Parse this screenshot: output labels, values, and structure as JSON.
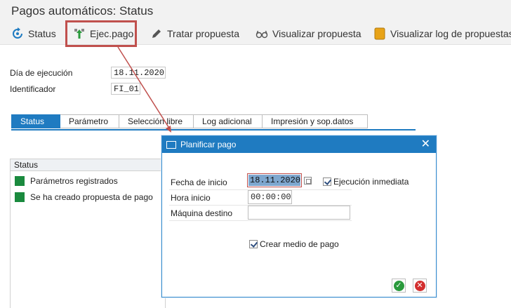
{
  "window": {
    "title": "Pagos automáticos: Status"
  },
  "toolbar": {
    "status": "Status",
    "ejec_pago": "Ejec.pago",
    "tratar_propuesta": "Tratar propuesta",
    "visualizar_propuesta": "Visualizar propuesta",
    "visualizar_log": "Visualizar log de propuestas"
  },
  "header": {
    "dia_label": "Día de ejecución",
    "dia_value": "18.11.2020",
    "id_label": "Identificador",
    "id_value": "FI_01"
  },
  "tabs": [
    "Status",
    "Parámetro",
    "Selección libre",
    "Log adicional",
    "Impresión y sop.datos"
  ],
  "status_panel": {
    "heading": "Status",
    "items": [
      "Parámetros registrados",
      "Se ha creado propuesta de pago"
    ],
    "item_color": "#1a8a3e"
  },
  "dialog": {
    "title": "Planificar pago",
    "fecha_label": "Fecha de inicio",
    "fecha_value": "18.11.2020",
    "ejecucion_inmediata": "Ejecución inmediata",
    "hora_label": "Hora inicio",
    "hora_value": "00:00:00",
    "maquina_label": "Máquina destino",
    "maquina_value": "",
    "crear_medio": "Crear medio de pago"
  },
  "colors": {
    "accent": "#1f7bc1",
    "highlight": "#c0504d",
    "ok": "#2a9a3c",
    "cancel": "#d32f2f"
  }
}
